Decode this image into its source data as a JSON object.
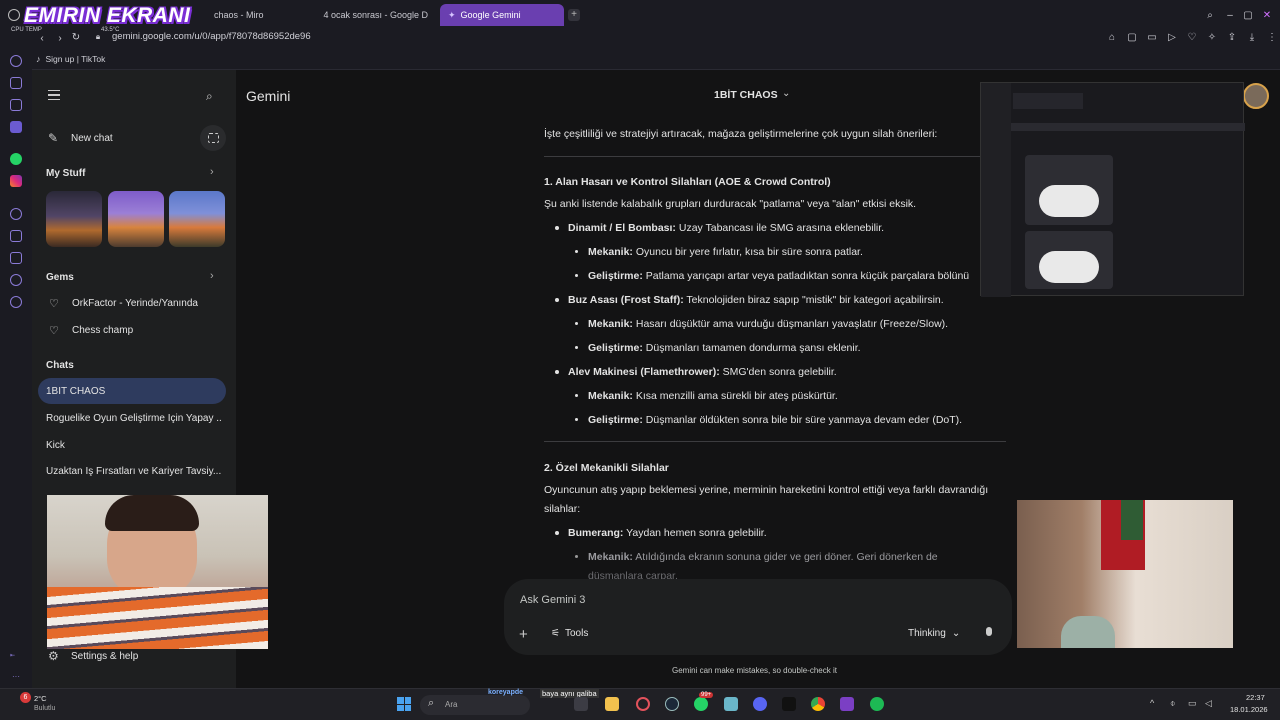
{
  "overlay": {
    "title": "EMIRIN EKRANI",
    "cpu_label": "CPU TEMP",
    "cpu_value": "43.5°C"
  },
  "tabs": [
    {
      "label": "chaos - Miro",
      "active": false
    },
    {
      "label": "4 ocak sonrası - Google D",
      "active": false
    },
    {
      "label": "Google Gemini",
      "active": true
    }
  ],
  "address": {
    "url": "gemini.google.com/u/0/app/f78078d86952de96"
  },
  "bookmarks": [
    {
      "label": "Sign up | TikTok"
    }
  ],
  "sidebar": {
    "new_chat": "New chat",
    "my_stuff": "My Stuff",
    "gems_heading": "Gems",
    "gems": [
      "OrkFactor - Yerinde/Yanında",
      "Chess champ"
    ],
    "chats_heading": "Chats",
    "chats": [
      "1BİT CHAOS",
      "Roguelike Oyun Geliştirme İçin Yapay ...",
      "Kick",
      "Uzaktan İş Fırsatları ve Kariyer Tavsiy..."
    ],
    "settings": "Settings & help"
  },
  "header": {
    "app_title": "Gemini",
    "chat_title": "1BİT CHAOS"
  },
  "content": {
    "intro": "İşte çeşitliliği ve stratejiyi artıracak, mağaza geliştirmelerine çok uygun silah önerileri:",
    "s1_heading": "1. Alan Hasarı ve Kontrol Silahları (AOE & Crowd Control)",
    "s1_desc": "Şu anki listende kalabalık grupları durduracak \"patlama\" veya \"alan\" etkisi eksik.",
    "items": [
      {
        "title": "Dinamit / El Bombası:",
        "text": " Uzay Tabancası ile SMG arasına eklenebilir.",
        "sub": [
          {
            "title": "Mekanik:",
            "text": " Oyuncu bir yere fırlatır, kısa bir süre sonra patlar."
          },
          {
            "title": "Geliştirme:",
            "text": " Patlama yarıçapı artar veya patladıktan sonra küçük parçalara bölünü"
          }
        ]
      },
      {
        "title": "Buz Asası (Frost Staff):",
        "text": " Teknolojiden biraz sapıp \"mistik\" bir kategori açabilirsin.",
        "sub": [
          {
            "title": "Mekanik:",
            "text": " Hasarı düşüktür ama vurduğu düşmanları yavaşlatır (Freeze/Slow)."
          },
          {
            "title": "Geliştirme:",
            "text": " Düşmanları tamamen dondurma şansı eklenir."
          }
        ]
      },
      {
        "title": "Alev Makinesi (Flamethrower):",
        "text": " SMG'den sonra gelebilir.",
        "sub": [
          {
            "title": "Mekanik:",
            "text": " Kısa menzilli ama sürekli bir ateş püskürtür."
          },
          {
            "title": "Geliştirme:",
            "text": " Düşmanlar öldükten sonra bile bir süre yanmaya devam eder (DoT)."
          }
        ]
      }
    ],
    "s2_heading": "2. Özel Mekanikli Silahlar",
    "s2_desc_1": "Oyuncunun atış yapıp beklemesi yerine, merminin hareketini kontrol ettiği veya farklı davrandığı",
    "s2_desc_2": "silahlar:",
    "boomerang_title": "Bumerang:",
    "boomerang_text": " Yaydan hemen sonra gelebilir.",
    "boomerang_mech_title": "Mekanik:",
    "boomerang_mech_text": " Atıldığında ekranın sonuna gider ve geri döner. Geri dönerken de",
    "boomerang_mech_cut": "düşmanlara çarpar."
  },
  "input": {
    "placeholder": "Ask Gemini 3",
    "tools": "Tools",
    "mode": "Thinking"
  },
  "disclaimer": "Gemini can make mistakes, so double-check it",
  "taskbar": {
    "weather_temp": "2°C",
    "weather_desc": "Bulutlu",
    "weather_badge": "6",
    "search": "Ara",
    "chat_user": "koreyapde",
    "chat_msg": "baya aynı galiba",
    "badge": "99+",
    "time": "22:37",
    "date": "18.01.2026"
  },
  "colors": {
    "accent_tab": "#6a3fb0",
    "active_chat": "#2e3b5e",
    "bg": "#131314",
    "sidebar": "#1e1f20"
  }
}
